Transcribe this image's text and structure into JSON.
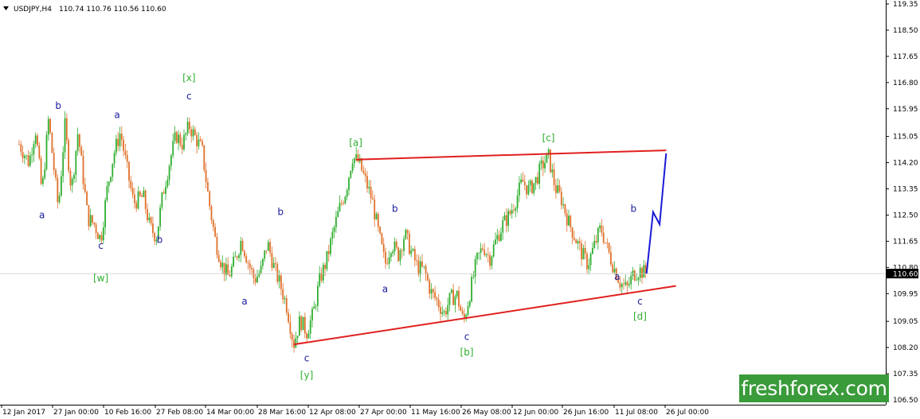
{
  "header": {
    "menu_icon": "triangle-down-icon",
    "symbol": "USDJPY,H4",
    "ohlc": "110.74 110.76 110.56 110.60"
  },
  "brand": {
    "text": "freshforex.com",
    "color": "#3a9b3a"
  },
  "chart_data": {
    "type": "candlestick",
    "instrument": "USDJPY",
    "timeframe": "H4",
    "open": 110.74,
    "high": 110.76,
    "low": 110.56,
    "close": 110.6,
    "current_price_label": "110.60",
    "y_range": [
      106.5,
      119.4
    ],
    "y_ticks": [
      "119.35",
      "118.50",
      "117.65",
      "116.80",
      "115.95",
      "115.05",
      "114.20",
      "113.35",
      "112.50",
      "111.65",
      "110.80",
      "109.95",
      "109.05",
      "108.20",
      "107.35",
      "106.50"
    ],
    "x_ticks": [
      "12 Jan 2017",
      "27 Jan 00:00",
      "10 Feb 16:00",
      "27 Feb 08:00",
      "14 Mar 00:00",
      "28 Mar 16:00",
      "12 Apr 08:00",
      "27 Apr 00:00",
      "11 May 16:00",
      "26 May 08:00",
      "12 Jun 00:00",
      "26 Jun 16:00",
      "11 Jul 08:00",
      "26 Jul 00:00"
    ],
    "price_path": [
      [
        "12 Jan 2017",
        114.8
      ],
      [
        "15 Jan",
        114.2
      ],
      [
        "17 Jan",
        115.3
      ],
      [
        "19 Jan",
        113.2
      ],
      [
        "21 Jan",
        115.6
      ],
      [
        "24 Jan",
        112.7
      ],
      [
        "26 Jan",
        115.4
      ],
      [
        "28 Jan",
        113.3
      ],
      [
        "30 Jan",
        115.2
      ],
      [
        "2 Feb",
        112.4
      ],
      [
        "4 Feb",
        112.2
      ],
      [
        "6 Feb",
        111.7
      ],
      [
        "8 Feb",
        113.4
      ],
      [
        "10 Feb",
        114.5
      ],
      [
        "12 Feb",
        115.2
      ],
      [
        "14 Feb",
        114.0
      ],
      [
        "16 Feb",
        112.9
      ],
      [
        "19 Feb",
        113.1
      ],
      [
        "21 Feb",
        112.1
      ],
      [
        "23 Feb",
        111.8
      ],
      [
        "25 Feb",
        113.2
      ],
      [
        "27 Feb",
        114.2
      ],
      [
        "1 Mar",
        115.1
      ],
      [
        "3 Mar",
        114.8
      ],
      [
        "5 Mar",
        115.4
      ],
      [
        "7 Mar",
        115.0
      ],
      [
        "9 Mar",
        114.6
      ],
      [
        "11 Mar",
        113.0
      ],
      [
        "13 Mar",
        111.7
      ],
      [
        "15 Mar",
        110.9
      ],
      [
        "17 Mar",
        110.5
      ],
      [
        "19 Mar",
        111.0
      ],
      [
        "21 Mar",
        111.7
      ],
      [
        "23 Mar",
        111.0
      ],
      [
        "25 Mar",
        110.4
      ],
      [
        "27 Mar",
        110.7
      ],
      [
        "29 Mar",
        111.6
      ],
      [
        "31 Mar",
        110.8
      ],
      [
        "2 Apr",
        110.2
      ],
      [
        "4 Apr",
        109.5
      ],
      [
        "6 Apr",
        108.3
      ],
      [
        "8 Apr",
        109.1
      ],
      [
        "10 Apr",
        108.7
      ],
      [
        "12 Apr",
        109.3
      ],
      [
        "14 Apr",
        110.4
      ],
      [
        "16 Apr",
        111.0
      ],
      [
        "18 Apr",
        111.9
      ],
      [
        "20 Apr",
        112.7
      ],
      [
        "22 Apr",
        113.3
      ],
      [
        "24 Apr",
        114.4
      ],
      [
        "26 Apr",
        114.2
      ],
      [
        "28 Apr",
        113.6
      ],
      [
        "30 Apr",
        113.0
      ],
      [
        "2 May",
        111.9
      ],
      [
        "4 May",
        110.9
      ],
      [
        "6 May",
        111.6
      ],
      [
        "8 May",
        111.2
      ],
      [
        "10 May",
        111.9
      ],
      [
        "12 May",
        111.3
      ],
      [
        "14 May",
        110.8
      ],
      [
        "16 May",
        110.7
      ],
      [
        "18 May",
        110.0
      ],
      [
        "20 May",
        109.7
      ],
      [
        "22 May",
        109.3
      ],
      [
        "24 May",
        109.8
      ],
      [
        "26 May",
        109.9
      ],
      [
        "28 May",
        109.0
      ],
      [
        "30 May",
        110.0
      ],
      [
        "1 Jun",
        111.0
      ],
      [
        "3 Jun",
        111.5
      ],
      [
        "5 Jun",
        111.1
      ],
      [
        "7 Jun",
        111.7
      ],
      [
        "9 Jun",
        112.2
      ],
      [
        "11 Jun",
        112.5
      ],
      [
        "13 Jun",
        113.0
      ],
      [
        "15 Jun",
        113.6
      ],
      [
        "17 Jun",
        113.3
      ],
      [
        "19 Jun",
        113.6
      ],
      [
        "21 Jun",
        114.1
      ],
      [
        "23 Jun",
        114.4
      ],
      [
        "25 Jun",
        113.4
      ],
      [
        "27 Jun",
        113.0
      ],
      [
        "29 Jun",
        112.3
      ],
      [
        "1 Jul",
        111.8
      ],
      [
        "3 Jul",
        111.3
      ],
      [
        "5 Jul",
        110.9
      ],
      [
        "7 Jul",
        111.5
      ],
      [
        "9 Jul",
        112.1
      ],
      [
        "11 Jul",
        111.4
      ],
      [
        "13 Jul",
        110.8
      ],
      [
        "15 Jul",
        110.3
      ],
      [
        "17 Jul",
        110.1
      ],
      [
        "19 Jul",
        110.6
      ],
      [
        "21 Jul",
        110.7
      ],
      [
        "23 Jul",
        110.6
      ]
    ],
    "forecast_path": [
      [
        "23 Jul",
        110.6
      ],
      [
        "25 Jul",
        112.6
      ],
      [
        "27 Jul",
        112.2
      ],
      [
        "29 Jul",
        114.5
      ]
    ],
    "trendlines": [
      {
        "name": "upper",
        "from": [
          "25 Apr",
          114.3
        ],
        "to": [
          "29 Jul",
          114.6
        ]
      },
      {
        "name": "lower",
        "from": [
          "6 Apr",
          108.3
        ],
        "to": [
          "1 Aug",
          110.2
        ]
      }
    ],
    "wave_labels": [
      {
        "text": "b",
        "color": "#1a1a9c",
        "date": "24 Jan",
        "price": 115.95
      },
      {
        "text": "a",
        "color": "#1a1a9c",
        "date": "19 Jan",
        "price": 112.4
      },
      {
        "text": "c",
        "color": "#1a1a9c",
        "date": "6 Feb",
        "price": 111.4
      },
      {
        "text": "[w]",
        "color": "#2fae2f",
        "date": "6 Feb",
        "price": 110.35
      },
      {
        "text": "a",
        "color": "#1a1a9c",
        "date": "11 Feb",
        "price": 115.65
      },
      {
        "text": "b",
        "color": "#1a1a9c",
        "date": "24 Feb",
        "price": 111.6
      },
      {
        "text": "[x]",
        "color": "#2fae2f",
        "date": "5 Mar",
        "price": 116.85
      },
      {
        "text": "c",
        "color": "#1a1a9c",
        "date": "5 Mar",
        "price": 116.25
      },
      {
        "text": "a",
        "color": "#1a1a9c",
        "date": "22 Mar",
        "price": 109.6
      },
      {
        "text": "b",
        "color": "#1a1a9c",
        "date": "2 Apr",
        "price": 112.5
      },
      {
        "text": "c",
        "color": "#1a1a9c",
        "date": "10 Apr",
        "price": 107.75
      },
      {
        "text": "[y]",
        "color": "#2fae2f",
        "date": "10 Apr",
        "price": 107.2
      },
      {
        "text": "[a]",
        "color": "#2fae2f",
        "date": "25 Apr",
        "price": 114.75
      },
      {
        "text": "a",
        "color": "#1a1a9c",
        "date": "4 May",
        "price": 110.0
      },
      {
        "text": "b",
        "color": "#1a1a9c",
        "date": "7 May",
        "price": 112.6
      },
      {
        "text": "c",
        "color": "#1a1a9c",
        "date": "29 May",
        "price": 108.45
      },
      {
        "text": "[b]",
        "color": "#2fae2f",
        "date": "29 May",
        "price": 107.95
      },
      {
        "text": "[c]",
        "color": "#2fae2f",
        "date": "23 Jun",
        "price": 114.9
      },
      {
        "text": "a",
        "color": "#1a1a9c",
        "date": "14 Jul",
        "price": 110.4
      },
      {
        "text": "b",
        "color": "#1a1a9c",
        "date": "19 Jul",
        "price": 112.6
      },
      {
        "text": "c",
        "color": "#1a1a9c",
        "date": "21 Jul",
        "price": 109.6
      },
      {
        "text": "[d]",
        "color": "#2fae2f",
        "date": "21 Jul",
        "price": 109.1
      }
    ],
    "colors": {
      "bull": "#2fae2f",
      "bear": "#e0702a",
      "trendline": "#e0201e",
      "forecast": "#1a1ad6",
      "axis": "#000000"
    },
    "grid": false
  }
}
